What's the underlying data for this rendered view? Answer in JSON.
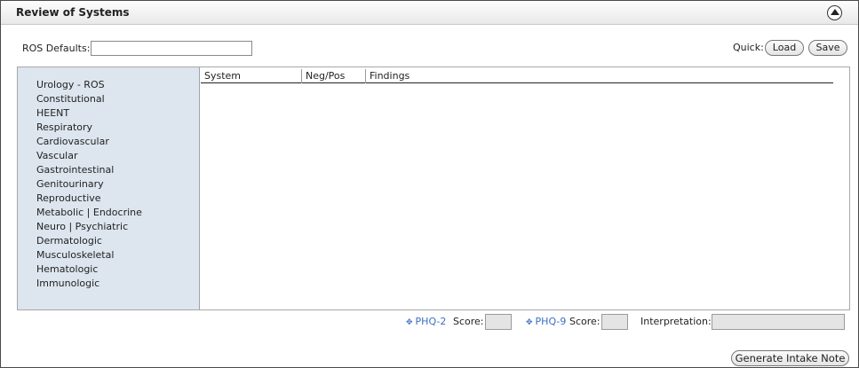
{
  "header": {
    "title": "Review of Systems"
  },
  "ros_defaults": {
    "label": "ROS Defaults:",
    "value": ""
  },
  "quick": {
    "label": "Quick:",
    "load_label": "Load",
    "save_label": "Save"
  },
  "sidebar": {
    "items": [
      {
        "label": "Urology - ROS"
      },
      {
        "label": "Constitutional"
      },
      {
        "label": "HEENT"
      },
      {
        "label": "Respiratory"
      },
      {
        "label": "Cardiovascular"
      },
      {
        "label": "Vascular"
      },
      {
        "label": "Gastrointestinal"
      },
      {
        "label": "Genitourinary"
      },
      {
        "label": "Reproductive"
      },
      {
        "label": "Metabolic | Endocrine"
      },
      {
        "label": "Neuro | Psychiatric"
      },
      {
        "label": "Dermatologic"
      },
      {
        "label": "Musculoskeletal"
      },
      {
        "label": "Hematologic"
      },
      {
        "label": "Immunologic"
      }
    ]
  },
  "grid": {
    "columns": [
      "System",
      "Neg/Pos",
      "Findings"
    ],
    "rows": []
  },
  "footer": {
    "phq2_label": "PHQ-2",
    "phq9_label": "PHQ-9",
    "score_label": "Score:",
    "phq2_score": "",
    "phq9_score": "",
    "interpretation_label": "Interpretation:",
    "interpretation_value": "",
    "diamond_icon": "✥"
  },
  "actions": {
    "generate_label": "Generate Intake Note"
  },
  "colors": {
    "sidebar_bg": "#dde6ef",
    "link": "#3a6fc4"
  }
}
